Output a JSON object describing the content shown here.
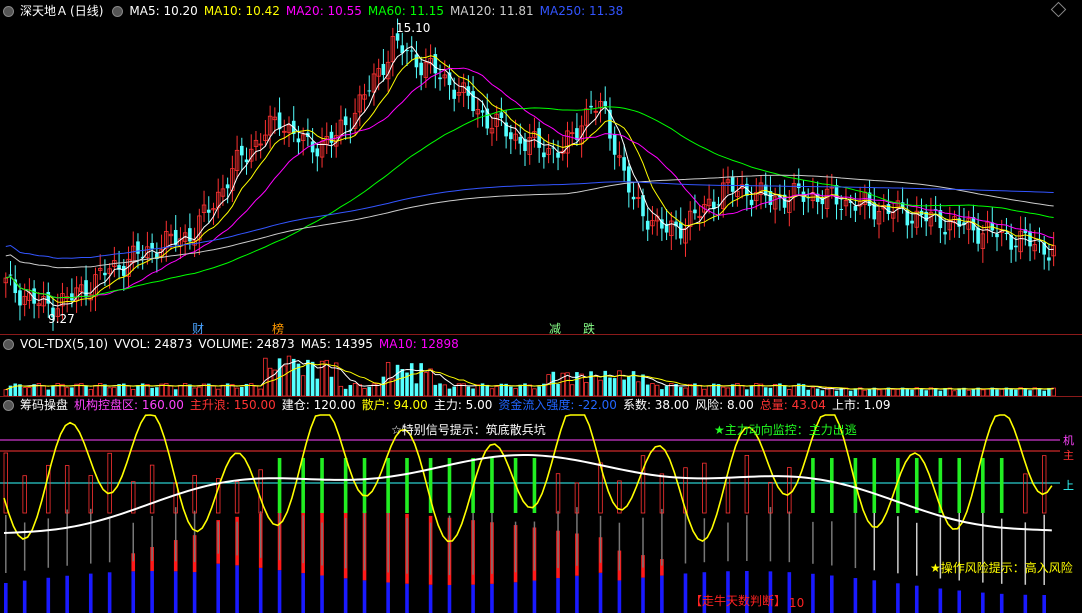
{
  "main": {
    "stock_name": "深天地Ａ",
    "period": "(日线)",
    "ma": [
      {
        "label": "MA5: 10.20",
        "color": "#ffffff"
      },
      {
        "label": "MA10: 10.42",
        "color": "#ffff00"
      },
      {
        "label": "MA20: 10.55",
        "color": "#ff00ff"
      },
      {
        "label": "MA60: 11.15",
        "color": "#00ff00"
      },
      {
        "label": "MA120: 11.81",
        "color": "#cccccc"
      },
      {
        "label": "MA250: 11.38",
        "color": "#3355ff"
      }
    ],
    "high_label": "15.10",
    "low_label": "9.27",
    "markers": [
      {
        "text": "财",
        "color": "#4aa3ff"
      },
      {
        "text": "榜",
        "color": "#ff9900"
      },
      {
        "text": "减",
        "color": "#88ff88"
      },
      {
        "text": "跌",
        "color": "#88ff88"
      }
    ]
  },
  "vol": {
    "title": "VOL-TDX(5,10)",
    "items": [
      {
        "label": "VVOL: 24873",
        "color": "#ffffff"
      },
      {
        "label": "VOLUME: 24873",
        "color": "#ffffff"
      },
      {
        "label": "MA5: 14395",
        "color": "#ffffff"
      },
      {
        "label": "MA10: 12898",
        "color": "#ff00ff"
      }
    ]
  },
  "ind": {
    "title": "筹码操盘",
    "items": [
      {
        "label": "机构控盘区: 160.00",
        "color": "#ff44ff"
      },
      {
        "label": "主升浪: 150.00",
        "color": "#ff3333"
      },
      {
        "label": "建仓: 120.00",
        "color": "#ffffff"
      },
      {
        "label": "散户: 94.00",
        "color": "#ffff00"
      },
      {
        "label": "主力: 5.00",
        "color": "#ffffff"
      },
      {
        "label": "资金流入强度: -22.00",
        "color": "#2266ff"
      },
      {
        "label": "系数: 38.00",
        "color": "#ffffff"
      },
      {
        "label": "风险: 8.00",
        "color": "#ffffff"
      },
      {
        "label": "总量: 43.04",
        "color": "#ff3333"
      },
      {
        "label": "上市: 1.09",
        "color": "#ffffff"
      }
    ],
    "signal_tip": "☆特别信号提示：筑底散兵坑",
    "main_force_tip": "★主力动向监控：主力出逃",
    "bottom_tip": "【走牛天数判断】",
    "bottom_num": "10",
    "risk_tip": "★操作风险提示：高入风险",
    "right_labels": [
      "机",
      "主",
      "上"
    ]
  },
  "colors": {
    "up": "#ff3232",
    "down": "#54ffff",
    "grid": "#8b1a1a"
  }
}
